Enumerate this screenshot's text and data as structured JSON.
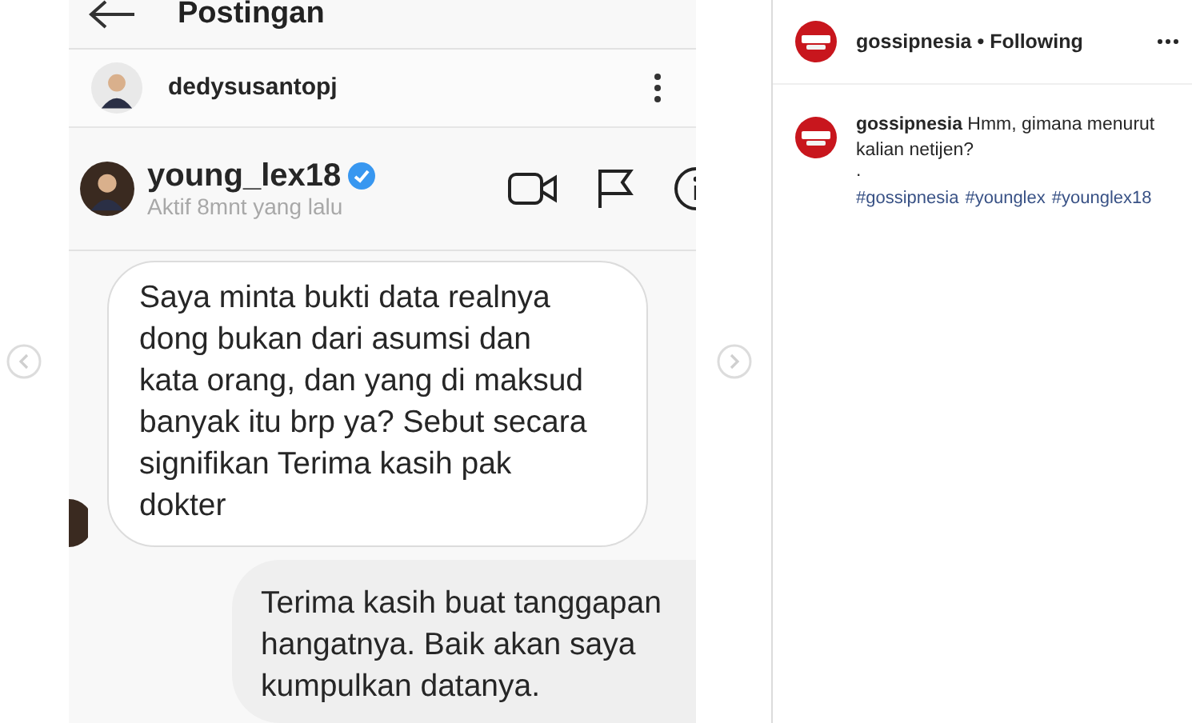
{
  "post_image": {
    "header_title": "Postingan",
    "author": "dedysusantopj",
    "chat": {
      "contact": "young_lex18",
      "verified": true,
      "status": "Aktif 8mnt yang lalu",
      "messages": [
        {
          "kind": "received",
          "text": "Saya minta bukti data realnya dong bukan dari asumsi dan kata orang, dan yang di maksud banyak itu brp ya? Sebut secara signifikan Terima kasih pak dokter"
        },
        {
          "kind": "sent",
          "text": "Terima kasih buat tanggapan hangatnya. Baik akan saya kumpulkan datanya."
        }
      ]
    }
  },
  "post_header": {
    "username": "gossipnesia",
    "separator": "•",
    "follow_status": "Following"
  },
  "caption": {
    "text": "**gossipnesia** Hmm, gimana menurut kalian netijen?",
    "dot": ".",
    "hashtags": [
      "#gossipnesia",
      "#younglex",
      "#younglex18"
    ]
  }
}
